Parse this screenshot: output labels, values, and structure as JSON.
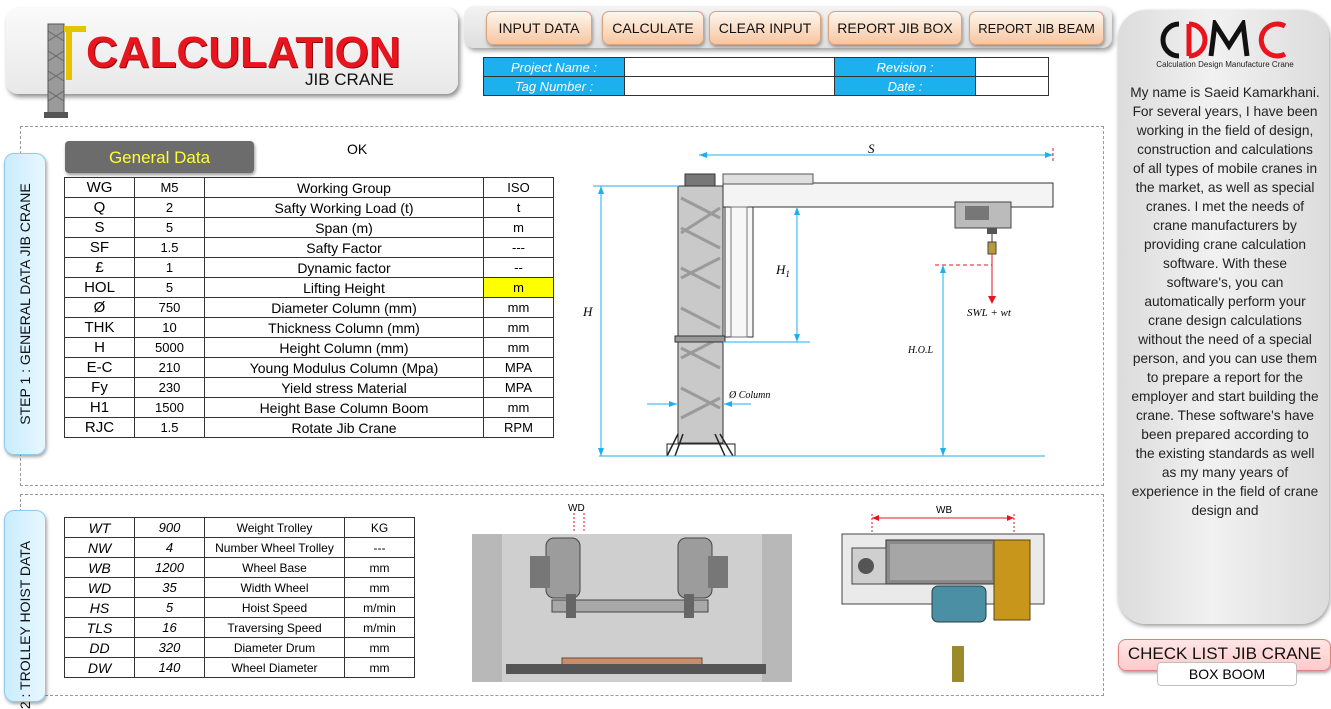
{
  "app": {
    "title": "CALCULATION",
    "subtitle": "JIB CRANE"
  },
  "toolbar": {
    "input_data": "INPUT DATA",
    "calculate": "CALCULATE",
    "clear_input": "CLEAR INPUT",
    "report_jib_box": "REPORT JIB BOX",
    "report_jib_beam": "REPORT JIB BEAM"
  },
  "project": {
    "project_name_label": "Project Name  :",
    "project_name_value": "",
    "revision_label": "Revision  :",
    "revision_value": "",
    "tag_number_label": "Tag Number  :",
    "tag_number_value": "",
    "date_label": "Date  :",
    "date_value": ""
  },
  "sidebar": {
    "logo_text": "CDMC",
    "logo_tagline": "Calculation Design Manufacture Crane",
    "bio": "My name is Saeid Kamarkhani. For several years, I have been working in the field of design, construction and calculations of all types of mobile cranes in the market, as well as special cranes. I met the needs of crane manufacturers by providing crane calculation software. With these software's, you can automatically perform your crane design calculations without the need of a special person, and you can use them to prepare a report for the employer and start building the crane. These software's have been prepared according to the existing standards as well as my many years of experience in the field of crane design and",
    "check_list": "CHECK LIST JIB CRANE",
    "box_boom": "BOX BOOM"
  },
  "step1": {
    "tab_label": "STEP 1 : GENERAL DATA JIB CRANE",
    "section_title": "General Data",
    "status": "OK",
    "rows": [
      {
        "sym": "WG",
        "val": "M5",
        "desc": "Working Group",
        "unit": "ISO"
      },
      {
        "sym": "Q",
        "val": "2",
        "desc": "Safty Working Load (t)",
        "unit": "t"
      },
      {
        "sym": "S",
        "val": "5",
        "desc": "Span (m)",
        "unit": "m"
      },
      {
        "sym": "SF",
        "val": "1.5",
        "desc": "Safty Factor",
        "unit": "---"
      },
      {
        "sym": "£",
        "val": "1",
        "desc": "Dynamic factor",
        "unit": "--"
      },
      {
        "sym": "HOL",
        "val": "5",
        "desc": "Lifting Height",
        "unit": "m"
      },
      {
        "sym": "Ø",
        "val": "750",
        "desc": "Diameter Column (mm)",
        "unit": "mm"
      },
      {
        "sym": "THK",
        "val": "10",
        "desc": "Thickness Column (mm)",
        "unit": "mm"
      },
      {
        "sym": "H",
        "val": "5000",
        "desc": "Height Column (mm)",
        "unit": "mm"
      },
      {
        "sym": "E-C",
        "val": "210",
        "desc": "Young Modulus Column (Mpa)",
        "unit": "MPA"
      },
      {
        "sym": "Fy",
        "val": "230",
        "desc": "Yield stress Material",
        "unit": "MPA"
      },
      {
        "sym": "H1",
        "val": "1500",
        "desc": "Height Base Column Boom",
        "unit": "mm"
      },
      {
        "sym": "RJC",
        "val": "1.5",
        "desc": "Rotate Jib Crane",
        "unit": "RPM"
      }
    ]
  },
  "step2": {
    "tab_label": "2 : TROLLEY HOIST DATA",
    "rows": [
      {
        "sym": "WT",
        "val": "900",
        "desc": "Weight Trolley",
        "unit": "KG"
      },
      {
        "sym": "NW",
        "val": "4",
        "desc": "Number Wheel Trolley",
        "unit": "---"
      },
      {
        "sym": "WB",
        "val": "1200",
        "desc": "Wheel Base",
        "unit": "mm"
      },
      {
        "sym": "WD",
        "val": "35",
        "desc": "Width Wheel",
        "unit": "mm"
      },
      {
        "sym": "HS",
        "val": "5",
        "desc": "Hoist Speed",
        "unit": "m/min"
      },
      {
        "sym": "TLS",
        "val": "16",
        "desc": "Traversing Speed",
        "unit": "m/min"
      },
      {
        "sym": "DD",
        "val": "320",
        "desc": "Diameter Drum",
        "unit": "mm"
      },
      {
        "sym": "DW",
        "val": "140",
        "desc": "Wheel Diameter",
        "unit": "mm"
      }
    ]
  },
  "diagram": {
    "span_label": "S",
    "h1_label": "H",
    "h1_sub": "1",
    "h_label": "H",
    "hol_label": "H.O.L",
    "load_label": "SWL + wt",
    "column_label": "Ø Column",
    "wd_label": "WD",
    "wb_label": "WB"
  },
  "colors": {
    "accent_red": "#e8141e",
    "label_blue": "#1cb0ee",
    "button_peach": "#f6c6a2",
    "highlight_yellow": "#ffff00",
    "dimension_cyan": "#1cb0ee"
  }
}
